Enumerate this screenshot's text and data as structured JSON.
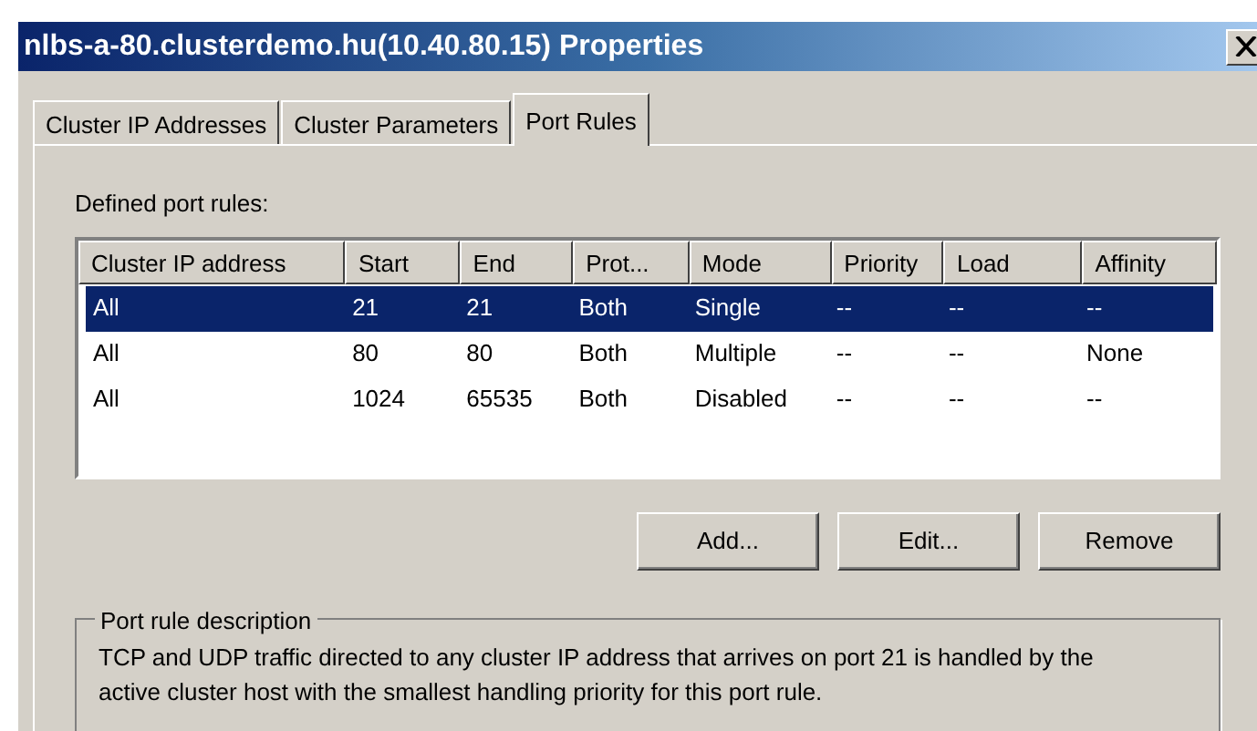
{
  "window": {
    "title": "nlbs-a-80.clusterdemo.hu(10.40.80.15) Properties"
  },
  "tabs": [
    {
      "label": "Cluster IP Addresses",
      "selected": false
    },
    {
      "label": "Cluster Parameters",
      "selected": false
    },
    {
      "label": "Port Rules",
      "selected": true
    }
  ],
  "port_rules": {
    "label": "Defined port rules:",
    "columns": [
      "Cluster IP address",
      "Start",
      "End",
      "Prot...",
      "Mode",
      "Priority",
      "Load",
      "Affinity"
    ],
    "rows": [
      {
        "cells": [
          "All",
          "21",
          "21",
          "Both",
          "Single",
          "--",
          "--",
          "--"
        ],
        "selected": true
      },
      {
        "cells": [
          "All",
          "80",
          "80",
          "Both",
          "Multiple",
          "--",
          "--",
          "None"
        ],
        "selected": false
      },
      {
        "cells": [
          "All",
          "1024",
          "65535",
          "Both",
          "Disabled",
          "--",
          "--",
          "--"
        ],
        "selected": false
      }
    ]
  },
  "buttons": [
    "Add...",
    "Edit...",
    "Remove"
  ],
  "description": {
    "title": "Port rule description",
    "text": "TCP and UDP traffic directed to any cluster IP address that arrives on port 21 is handled by the active cluster host with the smallest handling priority for this port rule."
  }
}
